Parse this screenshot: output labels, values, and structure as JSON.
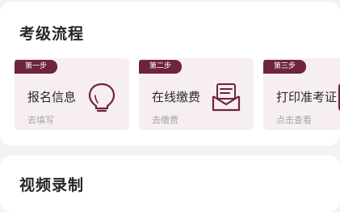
{
  "process": {
    "title": "考级流程",
    "steps": [
      {
        "badge": "第一步",
        "title": "报名信息",
        "sub": "去填写",
        "icon": "lightbulb-icon"
      },
      {
        "badge": "第二步",
        "title": "在线缴费",
        "sub": "去缴费",
        "icon": "envelope-icon"
      },
      {
        "badge": "第三步",
        "title": "打印准考证",
        "sub": "点击查看",
        "icon": "admission-ticket-icon"
      }
    ]
  },
  "video": {
    "title": "视频录制"
  },
  "colors": {
    "accent": "#6e2340",
    "card_tint": "#f6eef1",
    "background": "#f3f3f5"
  }
}
